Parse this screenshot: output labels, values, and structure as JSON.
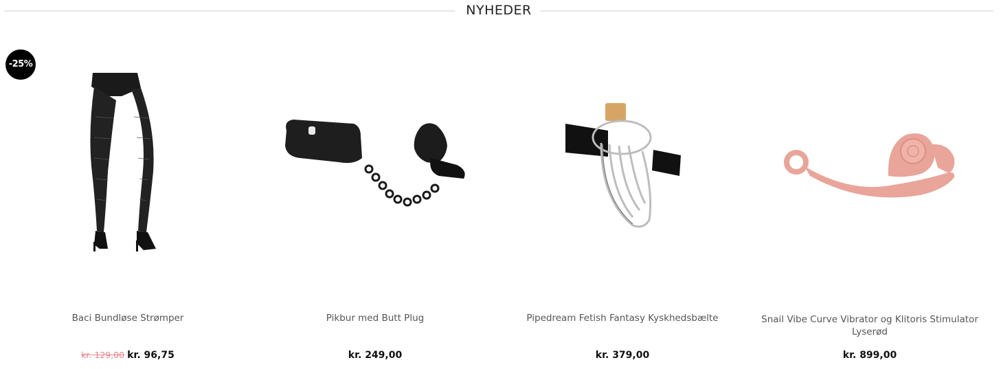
{
  "section": {
    "title": "NYHEDER"
  },
  "products": [
    {
      "name": "Baci Bundløse Strømper",
      "old_price": "kr. 129,00",
      "price": "kr. 96,75",
      "badge": "-25%"
    },
    {
      "name": "Pikbur med Butt Plug",
      "price": "kr. 249,00"
    },
    {
      "name": "Pipedream Fetish Fantasy Kyskhedsbælte",
      "price": "kr. 379,00"
    },
    {
      "name": "Snail Vibe Curve Vibrator og Klitoris Stimulator Lyserød",
      "price": "kr. 899,00"
    }
  ],
  "colors": {
    "old_price": "#e8838a",
    "badge_bg": "#000000",
    "divider": "#e6e6e6",
    "product_pink": "#e9a59a"
  }
}
